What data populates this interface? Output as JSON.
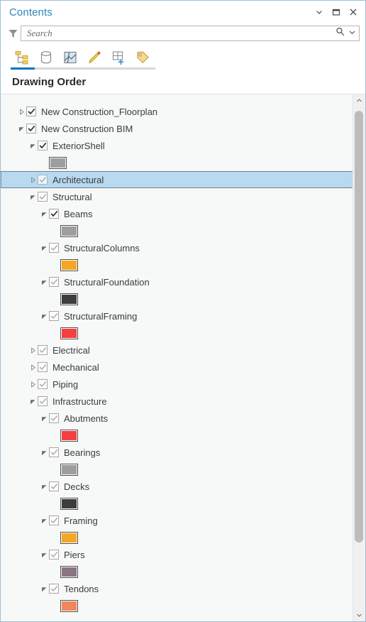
{
  "window": {
    "title": "Contents",
    "buttons": [
      {
        "name": "menu-chevron",
        "icon": "chevron-down-icon",
        "tooltip": "Menu"
      },
      {
        "name": "maximize",
        "icon": "restore-icon",
        "tooltip": "Maximize"
      },
      {
        "name": "close",
        "icon": "close-icon",
        "tooltip": "Close"
      }
    ]
  },
  "search": {
    "placeholder": "Search",
    "value": "",
    "filter_icon": "filter-icon",
    "search_icon": "magnifier-icon",
    "dropdown_icon": "chevron-down-icon"
  },
  "tabs": {
    "active_index": 0,
    "items": [
      {
        "label": "List By Drawing Order",
        "icon": "drawing-order-icon"
      },
      {
        "label": "List By Data Source",
        "icon": "data-source-icon"
      },
      {
        "label": "List By Selection",
        "icon": "selection-icon"
      },
      {
        "label": "List By Editing",
        "icon": "pencil-icon"
      },
      {
        "label": "List By Snapping",
        "icon": "grid-plus-icon"
      },
      {
        "label": "List By Labeling",
        "icon": "label-tag-icon"
      }
    ]
  },
  "section": {
    "title": "Drawing Order"
  },
  "tree": {
    "rows": [
      {
        "type": "layer",
        "label": "New Construction_Floorplan",
        "depth": 0,
        "expander": "collapsed",
        "checked": true,
        "check_style": "dark",
        "selected": false
      },
      {
        "type": "layer",
        "label": "New Construction BIM",
        "depth": 0,
        "expander": "expanded",
        "checked": true,
        "check_style": "dark",
        "selected": false
      },
      {
        "type": "layer",
        "label": "ExteriorShell",
        "depth": 1,
        "expander": "expanded",
        "checked": true,
        "check_style": "dark",
        "selected": false
      },
      {
        "type": "swatch",
        "depth": 2,
        "color": "#9e9e9e"
      },
      {
        "type": "layer",
        "label": "Architectural",
        "depth": 1,
        "expander": "collapsed",
        "checked": true,
        "check_style": "light",
        "selected": true
      },
      {
        "type": "layer",
        "label": "Structural",
        "depth": 1,
        "expander": "expanded",
        "checked": true,
        "check_style": "light",
        "selected": false
      },
      {
        "type": "layer",
        "label": "Beams",
        "depth": 2,
        "expander": "expanded",
        "checked": true,
        "check_style": "dark",
        "selected": false
      },
      {
        "type": "swatch",
        "depth": 3,
        "color": "#9e9e9e"
      },
      {
        "type": "layer",
        "label": "StructuralColumns",
        "depth": 2,
        "expander": "expanded",
        "checked": true,
        "check_style": "light",
        "selected": false
      },
      {
        "type": "swatch",
        "depth": 3,
        "color": "#f5a623"
      },
      {
        "type": "layer",
        "label": "StructuralFoundation",
        "depth": 2,
        "expander": "expanded",
        "checked": true,
        "check_style": "light",
        "selected": false
      },
      {
        "type": "swatch",
        "depth": 3,
        "color": "#3d3d3d"
      },
      {
        "type": "layer",
        "label": "StructuralFraming",
        "depth": 2,
        "expander": "expanded",
        "checked": true,
        "check_style": "light",
        "selected": false
      },
      {
        "type": "swatch",
        "depth": 3,
        "color": "#f5403f"
      },
      {
        "type": "layer",
        "label": "Electrical",
        "depth": 1,
        "expander": "collapsed",
        "checked": true,
        "check_style": "light",
        "selected": false
      },
      {
        "type": "layer",
        "label": "Mechanical",
        "depth": 1,
        "expander": "collapsed",
        "checked": true,
        "check_style": "light",
        "selected": false
      },
      {
        "type": "layer",
        "label": "Piping",
        "depth": 1,
        "expander": "collapsed",
        "checked": true,
        "check_style": "light",
        "selected": false
      },
      {
        "type": "layer",
        "label": "Infrastructure",
        "depth": 1,
        "expander": "expanded",
        "checked": true,
        "check_style": "light",
        "selected": false
      },
      {
        "type": "layer",
        "label": "Abutments",
        "depth": 2,
        "expander": "expanded",
        "checked": true,
        "check_style": "light",
        "selected": false
      },
      {
        "type": "swatch",
        "depth": 3,
        "color": "#f5403f"
      },
      {
        "type": "layer",
        "label": "Bearings",
        "depth": 2,
        "expander": "expanded",
        "checked": true,
        "check_style": "light",
        "selected": false
      },
      {
        "type": "swatch",
        "depth": 3,
        "color": "#9e9e9e"
      },
      {
        "type": "layer",
        "label": "Decks",
        "depth": 2,
        "expander": "expanded",
        "checked": true,
        "check_style": "light",
        "selected": false
      },
      {
        "type": "swatch",
        "depth": 3,
        "color": "#3d3d3d"
      },
      {
        "type": "layer",
        "label": "Framing",
        "depth": 2,
        "expander": "expanded",
        "checked": true,
        "check_style": "light",
        "selected": false
      },
      {
        "type": "swatch",
        "depth": 3,
        "color": "#f5a623"
      },
      {
        "type": "layer",
        "label": "Piers",
        "depth": 2,
        "expander": "expanded",
        "checked": true,
        "check_style": "light",
        "selected": false
      },
      {
        "type": "swatch",
        "depth": 3,
        "color": "#8a7584"
      },
      {
        "type": "layer",
        "label": "Tendons",
        "depth": 2,
        "expander": "expanded",
        "checked": true,
        "check_style": "light",
        "selected": false
      },
      {
        "type": "swatch",
        "depth": 3,
        "color": "#f0865a"
      }
    ]
  },
  "scrollbar": {
    "up_icon": "chevron-up-icon",
    "down_icon": "chevron-down-icon"
  },
  "colors": {
    "accent": "#0072c6",
    "title": "#2d84bd",
    "selection": "#b8d9ef",
    "pane_border": "#9dc0d8"
  }
}
